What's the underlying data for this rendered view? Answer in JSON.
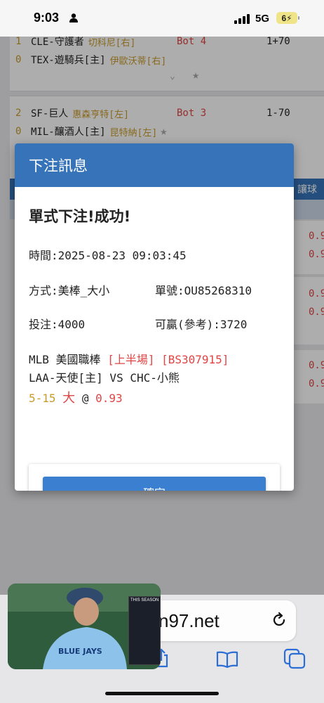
{
  "status_bar": {
    "time": "9:03",
    "network": "5G",
    "battery": "6"
  },
  "background": {
    "games": [
      {
        "home_num": "1",
        "home_team": "CLE-守護者",
        "home_pitcher": "切科尼[右]",
        "away_num": "0",
        "away_team": "TEX-遊騎兵[主]",
        "away_pitcher": "伊歐沃蒂[右]",
        "inning": "Bot 4",
        "spread": "1+70"
      },
      {
        "home_num": "2",
        "home_team": "SF-巨人",
        "home_pitcher": "惠森亨特[左]",
        "away_num": "0",
        "away_team": "MIL-釀酒人[主]",
        "away_pitcher": "昆特納[左]",
        "inning": "Bot 3",
        "spread": "1-70"
      }
    ],
    "side_header": "讓球",
    "side_odds": [
      "0.9",
      "0.9",
      "0.9",
      "0.9",
      "0.9",
      "0.9"
    ]
  },
  "modal": {
    "title": "下注訊息",
    "success": "單式下注!成功!",
    "time_label": "時間:",
    "time_value": "2025-08-23 09:03:45",
    "method_label": "方式:",
    "method_value": "美棒_大小",
    "ticket_label": "單號:",
    "ticket_value": "OU85268310",
    "stake_label": "投注:",
    "stake_value": "4000",
    "win_label": "可贏(參考):",
    "win_value": "3720",
    "league": "MLB 美國職棒",
    "period": "[上半場]",
    "code": "[BS307915]",
    "matchup": "LAA-天使[主] VS CHC-小熊",
    "score": "5-15",
    "pick": "大",
    "at": "@",
    "odds": "0.93",
    "confirm_label": "確定"
  },
  "browser": {
    "url": "n97.net"
  },
  "pip": {
    "stats_title": "THIS SEASON"
  },
  "colors": {
    "header_blue": "#3673b8",
    "button_blue": "#3b7fd0",
    "red": "#e04545",
    "gold": "#c89b2a"
  }
}
